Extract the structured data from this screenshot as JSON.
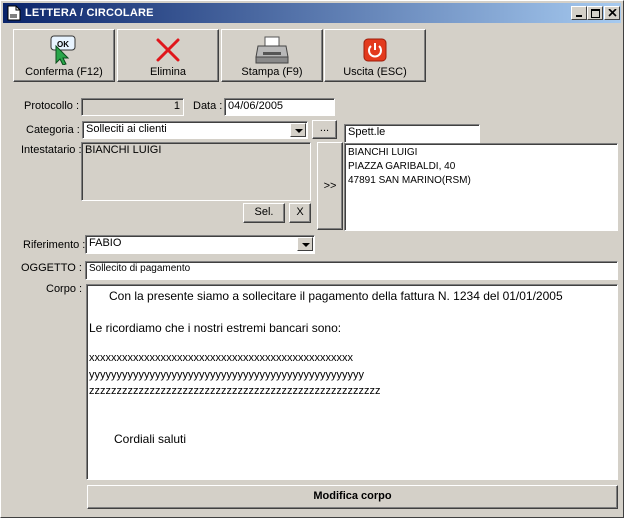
{
  "window": {
    "title": "LETTERA / CIRCOLARE"
  },
  "titlebar_buttons": {
    "minimize": "minimize-icon",
    "maximize": "maximize-icon",
    "close": "close-icon"
  },
  "toolbar": {
    "confirm": {
      "label": "Conferma (F12)",
      "icon": "ok-cursor-icon"
    },
    "delete": {
      "label": "Elimina",
      "icon": "red-x-icon"
    },
    "print": {
      "label": "Stampa (F9)",
      "icon": "printer-icon"
    },
    "exit": {
      "label": "Uscita (ESC)",
      "icon": "power-icon"
    }
  },
  "form": {
    "protocollo_label": "Protocollo :",
    "protocollo_value": "1",
    "data_label": "Data :",
    "data_value": "04/06/2005",
    "categoria_label": "Categoria :",
    "categoria_value": "Solleciti ai clienti",
    "categoria_more": "...",
    "spett_value": "Spett.le",
    "intestatario_label": "Intestatario :",
    "intestatario_value": "BIANCHI LUIGI",
    "sel_label": "Sel.",
    "clear_label": "X",
    "copy_label": ">>",
    "address_lines": [
      "BIANCHI LUIGI",
      "PIAZZA GARIBALDI, 40",
      "47891 SAN MARINO(RSM)"
    ],
    "riferimento_label": "Riferimento :",
    "riferimento_value": "FABIO",
    "oggetto_label": "OGGETTO :",
    "oggetto_value": "Sollecito di pagamento",
    "corpo_label": "Corpo :",
    "corpo_lines": [
      "Con la presente siamo a sollecitare il pagamento della fattura N. 1234 del 01/01/2005",
      "Le ricordiamo che i nostri estremi bancari sono:",
      "xxxxxxxxxxxxxxxxxxxxxxxxxxxxxxxxxxxxxxxxxxxxxxxx",
      "yyyyyyyyyyyyyyyyyyyyyyyyyyyyyyyyyyyyyyyyyyyyyyyyyy",
      "zzzzzzzzzzzzzzzzzzzzzzzzzzzzzzzzzzzzzzzzzzzzzzzzzzzzz",
      "Cordiali saluti"
    ],
    "modifica_label": "Modifica corpo"
  }
}
